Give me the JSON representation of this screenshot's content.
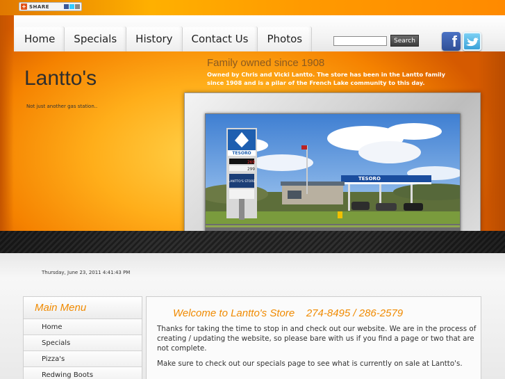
{
  "share": {
    "label": "SHARE"
  },
  "nav": {
    "tabs": [
      {
        "label": "Home"
      },
      {
        "label": "Specials"
      },
      {
        "label": "History"
      },
      {
        "label": "Contact Us"
      },
      {
        "label": "Photos"
      }
    ],
    "search_value": "",
    "search_button": "Search"
  },
  "social": {
    "facebook_glyph": "f",
    "twitter_glyph": "t"
  },
  "site": {
    "title": "Lantto's",
    "tagline": "Not just another gas station.."
  },
  "hero": {
    "heading": "Family owned since 1908",
    "description": "Owned by Chris and Vicki Lantto. The store has been in the Lantto family since 1908 and is a pilar of the French Lake community to this day."
  },
  "photo": {
    "sign_brand": "TESORO",
    "price_1": "269",
    "price_2": "299",
    "store_sign": "LANTTO'S STORE",
    "canopy_brand": "TESORO"
  },
  "datetime": "Thursday, June 23, 2011 4:41:43 PM",
  "main_menu": {
    "title": "Main Menu",
    "items": [
      {
        "label": "Home"
      },
      {
        "label": "Specials"
      },
      {
        "label": "Pizza's"
      },
      {
        "label": "Redwing Boots"
      }
    ]
  },
  "content": {
    "welcome": "Welcome to Lantto's Store    274-8495 / 286-2579",
    "paragraph_1": "Thanks for taking the time to stop in and check out our website.  We are in the process of creating / updating the website, so please bare with us if you find a page or two that are not complete.",
    "paragraph_2": "Make sure to check out our specials page to see what is currently on sale at Lantto's."
  },
  "colors": {
    "accent": "#f08a00",
    "orange_bg": "#ff9a00",
    "dark_band": "#2b2b2b"
  }
}
